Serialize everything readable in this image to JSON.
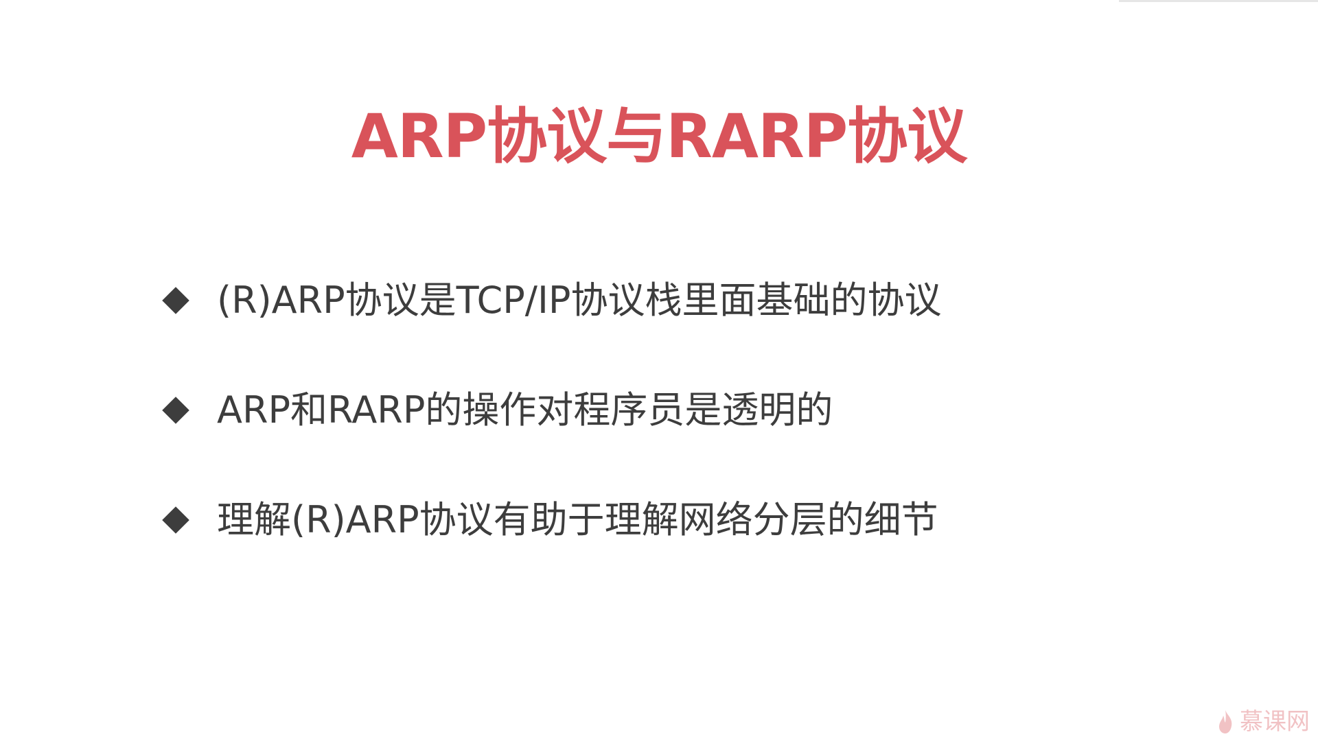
{
  "slide": {
    "title": "ARP协议与RARP协议",
    "bullets": [
      {
        "text": "(R)ARP协议是TCP/IP协议栈里面基础的协议"
      },
      {
        "text": "ARP和RARP的操作对程序员是透明的"
      },
      {
        "text": "理解(R)ARP协议有助于理解网络分层的细节"
      }
    ],
    "watermark": "慕课网"
  },
  "colors": {
    "title": "#d9535a",
    "bullet_text": "#3d3d3d",
    "background": "#ffffff"
  },
  "icons": {
    "bullet": "diamond-bullet-icon",
    "watermark_logo": "flame-icon"
  }
}
